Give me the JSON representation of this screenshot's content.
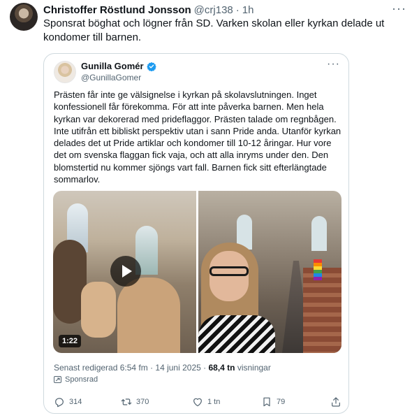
{
  "outer": {
    "name": "Christoffer Röstlund Jonsson",
    "handle": "@crj138",
    "dot": "·",
    "time": "1h",
    "more": "···",
    "text": "Sponsrat böghat och lögner från SD. Varken skolan eller kyrkan delade ut kondomer till barnen."
  },
  "quoted": {
    "name": "Gunilla Gomér",
    "handle": "@GunillaGomer",
    "more": "···",
    "text": "Prästen får inte ge välsignelse i kyrkan på skolavslutningen. Inget konfessionell får förekomma. För att inte påverka barnen. Men hela kyrkan var dekorerad med prideflaggor. Prästen talade om regnbågen. Inte utifrån ett bibliskt perspektiv utan i sann Pride anda. Utanför kyrkan delades det ut Pride artiklar och kondomer till 10-12 åringar. Hur vore det om svenska flaggan fick vaja, och att alla inryms under den. Den blomstertid nu kommer sjöngs vart fall. Barnen fick sitt efterlängtade sommarlov.",
    "video_duration": "1:22",
    "meta_prefix": "Senast redigerad 6:54 fm · 14 juni 2025 · ",
    "views_count": "68,4 tn",
    "views_label": " visningar",
    "sponsored_label": "Sponsrad"
  },
  "actions": {
    "replies": "314",
    "reposts": "370",
    "likes": "1 tn",
    "bookmarks": "79"
  },
  "colors": {
    "text": "#0f1419",
    "secondary": "#536471",
    "border": "#cfd9de",
    "verified": "#1d9bf0"
  }
}
